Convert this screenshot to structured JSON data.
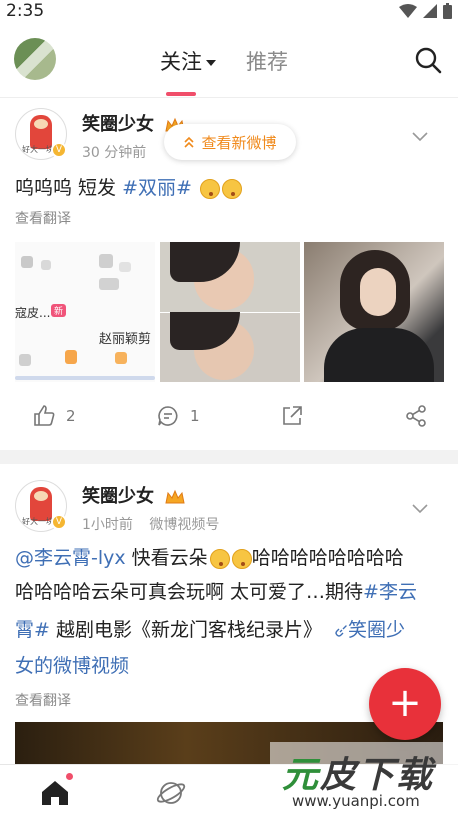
{
  "status_bar": {
    "time": "2:35"
  },
  "header": {
    "tabs": [
      {
        "label": "关注"
      },
      {
        "label": "推荐"
      }
    ]
  },
  "posts": [
    {
      "username": "笑圈少女",
      "time": "30 分钟前",
      "new_posts_button": "查看新微博",
      "text_plain": "呜呜呜 短发",
      "topic": "#双丽#",
      "translate": "查看翻译",
      "image1": {
        "label1": "寇皮...",
        "tag": "新",
        "label2": "赵丽颖剪"
      },
      "likes": "2",
      "comments": "1"
    },
    {
      "username": "笑圈少女",
      "time": "1小时前",
      "source": "微博视频号",
      "mention": "@李云霄-lyx",
      "text1": "快看云朵",
      "line1_rest": "哈哈哈哈哈哈哈哈",
      "line2": "哈哈哈哈云朵可真会玩啊 太可爱了…期待",
      "topic_part1": "#李云",
      "topic_part2": "霄#",
      "line3_rest": " 越剧电影《新龙门客栈纪录片》",
      "link_part1": "笑圈少",
      "link_part2": "女的微博视频",
      "translate": "查看翻译"
    }
  ],
  "avatar_caption": "好大一块",
  "fab": "+",
  "watermark": {
    "title_a": "元",
    "title_b": "皮下载",
    "url": "www.yuanpi.com"
  },
  "colors": {
    "accent": "#e8313a",
    "topic": "#3f6fb5",
    "highlight": "#f08a1c"
  }
}
